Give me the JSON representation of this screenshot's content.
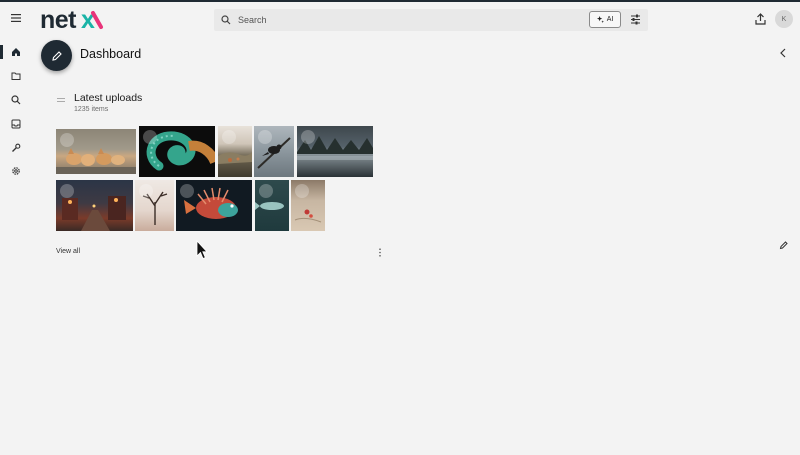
{
  "header": {
    "logo_text": "netx",
    "search_placeholder": "Search",
    "ai_label": "AI",
    "avatar_initial": "K",
    "icons": [
      "hamburger-menu-icon",
      "search-icon",
      "sparkle-icon",
      "sliders-icon",
      "upload-icon"
    ]
  },
  "sidebar": {
    "items": [
      "home",
      "folder",
      "search",
      "inbox",
      "wrench",
      "gear"
    ],
    "active": "home"
  },
  "page": {
    "title": "Dashboard"
  },
  "latest_uploads": {
    "title": "Latest uploads",
    "count": "1235 items",
    "view_all": "View all",
    "thumbnails": [
      "fox-kits",
      "chameleon-tail",
      "coastal-landscape",
      "bird-on-branch",
      "misty-forest-lake",
      "lit-street-night",
      "dead-tree-desert",
      "lionfish-illustration",
      "fish-in-water",
      "sandy-shore-flowers"
    ]
  },
  "colors": {
    "dark": "#1f2a33",
    "logo_teal": "#19b3a6",
    "logo_pink": "#e8347a",
    "background": "#f3f3f3"
  }
}
